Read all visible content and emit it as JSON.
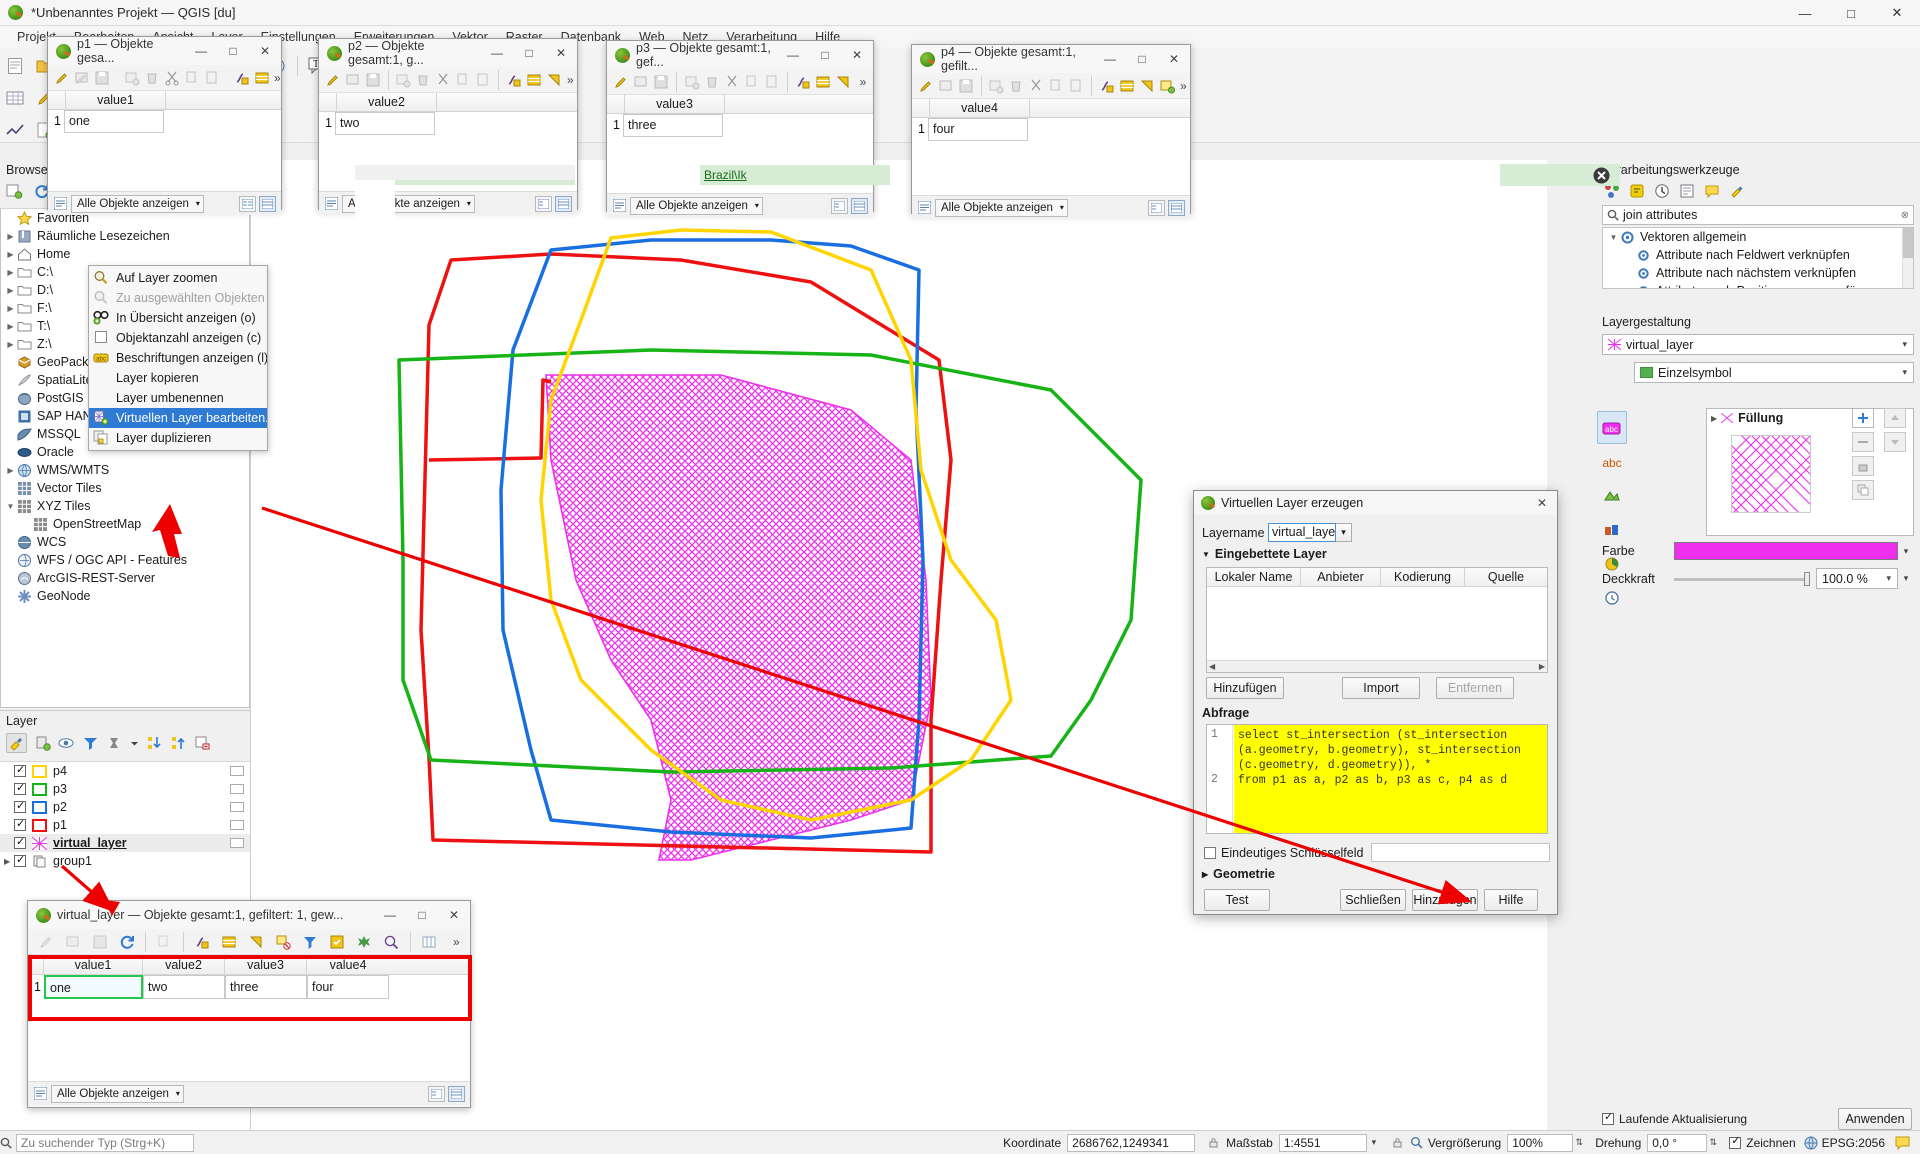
{
  "window": {
    "title": "*Unbenanntes Projekt — QGIS [du]",
    "minimize": "—",
    "maximize": "□",
    "close": "✕"
  },
  "menubar": [
    "Projekt",
    "Bearbeiten",
    "Ansicht",
    "Layer",
    "Einstellungen",
    "Erweiterungen",
    "Vektor",
    "Raster",
    "Datenbank",
    "Web",
    "Netz",
    "Verarbeitung",
    "Hilfe"
  ],
  "browser": {
    "title": "Browser",
    "items": [
      {
        "label": "Favoriten",
        "icon": "star-icon",
        "arrow": false,
        "indent": 0
      },
      {
        "label": "Räumliche Lesezeichen",
        "icon": "bookmark-icon",
        "arrow": true,
        "indent": 0
      },
      {
        "label": "Home",
        "icon": "home-icon",
        "arrow": true,
        "indent": 0
      },
      {
        "label": "C:\\",
        "icon": "folder-icon",
        "arrow": true,
        "indent": 0
      },
      {
        "label": "D:\\",
        "icon": "folder-icon",
        "arrow": true,
        "indent": 0
      },
      {
        "label": "F:\\",
        "icon": "folder-icon",
        "arrow": true,
        "indent": 0
      },
      {
        "label": "T:\\",
        "icon": "folder-icon",
        "arrow": true,
        "indent": 0
      },
      {
        "label": "Z:\\",
        "icon": "folder-icon",
        "arrow": true,
        "indent": 0
      },
      {
        "label": "GeoPackage",
        "icon": "geopackage-icon",
        "arrow": false,
        "indent": 0
      },
      {
        "label": "SpatiaLite",
        "icon": "spatialite-icon",
        "arrow": false,
        "indent": 0
      },
      {
        "label": "PostGIS",
        "icon": "postgis-icon",
        "arrow": false,
        "indent": 0
      },
      {
        "label": "SAP HANA",
        "icon": "saphana-icon",
        "arrow": false,
        "indent": 0
      },
      {
        "label": "MSSQL",
        "icon": "mssql-icon",
        "arrow": false,
        "indent": 0
      },
      {
        "label": "Oracle",
        "icon": "oracle-icon",
        "arrow": false,
        "indent": 0
      },
      {
        "label": "WMS/WMTS",
        "icon": "wms-icon",
        "arrow": true,
        "indent": 0
      },
      {
        "label": "Vector Tiles",
        "icon": "vectortiles-icon",
        "arrow": false,
        "indent": 0
      },
      {
        "label": "XYZ Tiles",
        "icon": "xyztiles-icon",
        "arrow": true,
        "expanded": true,
        "indent": 0
      },
      {
        "label": "OpenStreetMap",
        "icon": "xyztiles-icon",
        "arrow": false,
        "indent": 1
      },
      {
        "label": "WCS",
        "icon": "wcs-icon",
        "arrow": false,
        "indent": 0
      },
      {
        "label": "WFS / OGC API - Features",
        "icon": "wfs-icon",
        "arrow": false,
        "indent": 0
      },
      {
        "label": "ArcGIS-REST-Server",
        "icon": "arcgis-icon",
        "arrow": false,
        "indent": 0
      },
      {
        "label": "GeoNode",
        "icon": "geonode-icon",
        "arrow": false,
        "indent": 0
      }
    ]
  },
  "layers": {
    "title": "Layer",
    "items": [
      {
        "label": "p4",
        "color": "#ffd400",
        "checked": true,
        "type": "vector",
        "bold": false
      },
      {
        "label": "p3",
        "color": "#17b417",
        "checked": true,
        "type": "vector",
        "bold": false
      },
      {
        "label": "p2",
        "color": "#1a6fe0",
        "checked": true,
        "type": "vector",
        "bold": false
      },
      {
        "label": "p1",
        "color": "#ee1111",
        "checked": true,
        "type": "vector",
        "bold": false
      },
      {
        "label": "virtual_layer",
        "color": "#e040e0",
        "checked": true,
        "type": "virtual",
        "bold": true,
        "selected": true
      },
      {
        "label": "group1",
        "color": "",
        "checked": true,
        "type": "group",
        "bold": false,
        "arrow": true
      }
    ]
  },
  "context_menu": {
    "items": [
      {
        "label": "Auf Layer zoomen",
        "icon": "zoom-layer-icon",
        "state": "normal"
      },
      {
        "label": "Zu ausgewählten Objekten zoomen",
        "icon": "zoom-selection-icon",
        "state": "disabled"
      },
      {
        "label": "In Übersicht anzeigen (o)",
        "icon": "overview-icon",
        "state": "normal"
      },
      {
        "label": "Objektanzahl anzeigen (c)",
        "icon": "checkbox-icon",
        "state": "normal"
      },
      {
        "label": "Beschriftungen anzeigen (l)",
        "icon": "labels-icon",
        "state": "normal"
      },
      {
        "label": "Layer kopieren",
        "icon": "",
        "state": "normal"
      },
      {
        "label": "Layer umbenennen",
        "icon": "",
        "state": "normal"
      },
      {
        "label": "Virtuellen Layer bearbeiten...",
        "icon": "virtual-layer-icon",
        "state": "highlighted"
      },
      {
        "label": "Layer duplizieren",
        "icon": "duplicate-icon",
        "state": "normal"
      }
    ]
  },
  "attribute_windows": [
    {
      "id": "p1",
      "title": "p1 — Objekte gesa...",
      "column": "value1",
      "row_number": "1",
      "value": "one",
      "status_label": "Alle Objekte anzeigen"
    },
    {
      "id": "p2",
      "title": "p2 — Objekte gesamt:1, g...",
      "column": "value2",
      "row_number": "1",
      "value": "two",
      "status_label": "Alle Objekte anzeigen"
    },
    {
      "id": "p3",
      "title": "p3 — Objekte gesamt:1, gef...",
      "column": "value3",
      "row_number": "1",
      "value": "three",
      "status_label": "Alle Objekte anzeigen"
    },
    {
      "id": "p4",
      "title": "p4 — Objekte gesamt:1, gefilt...",
      "column": "value4",
      "row_number": "1",
      "value": "four",
      "status_label": "Alle Objekte anzeigen"
    }
  ],
  "virtual_table": {
    "title": "virtual_layer — Objekte gesamt:1, gefiltert: 1, gew...",
    "columns": [
      "value1",
      "value2",
      "value3",
      "value4"
    ],
    "row_number": "1",
    "row": [
      "one",
      "two",
      "three",
      "four"
    ],
    "status_label": "Alle Objekte anzeigen"
  },
  "processing": {
    "title": "Verarbeitungswerkzeuge",
    "search_value": "join attributes",
    "tree": [
      {
        "label": "Vektoren allgemein",
        "icon": "folder-gear-icon",
        "indent": 0,
        "arrow": true
      },
      {
        "label": "Attribute nach Feldwert verknüpfen",
        "icon": "gear-icon",
        "indent": 1
      },
      {
        "label": "Attribute nach nächstem verknüpfen",
        "icon": "gear-icon",
        "indent": 1
      },
      {
        "label": "Attribute nach Position zusammenfügen",
        "icon": "gear-icon",
        "indent": 1
      }
    ]
  },
  "styling": {
    "title": "Layergestaltung",
    "layer_value": "virtual_layer",
    "renderer_value": "Einzelsymbol",
    "tree_root": "Füllung",
    "color_label": "Farbe",
    "color_value": "#ee30ee",
    "opacity_label": "Deckkraft",
    "opacity_value": "100.0 %",
    "sidetabs": [
      "symbology-icon",
      "labels-icon",
      "masks-icon",
      "3dview-icon",
      "diagrams-icon",
      "history-icon"
    ]
  },
  "virtual_dialog": {
    "title": "Virtuellen Layer erzeugen",
    "layername_label": "Layername",
    "layername_value": "virtual_layer",
    "embedded_group": "Eingebettete Layer",
    "table_headers": [
      "Lokaler Name",
      "Anbieter",
      "Kodierung",
      "Quelle"
    ],
    "buttons_row": [
      "Hinzufügen",
      "Import",
      "Entfernen"
    ],
    "query_label": "Abfrage",
    "query_lines": [
      {
        "no": "1",
        "text": "select st_intersection (st_intersection (a.geometry, b.geometry), st_intersection (c.geometry, d.geometry)), *"
      },
      {
        "no": "2",
        "text": "from p1 as a, p2 as b, p3 as c, p4 as d"
      }
    ],
    "unique_key_label": "Eindeutiges Schlüsselfeld",
    "geometry_group": "Geometrie",
    "footer_buttons": [
      "Test",
      "Schließen",
      "Hinzufügen",
      "Hilfe"
    ],
    "close_icon": "✕"
  },
  "statusbar": {
    "search_placeholder": "Zu suchender Typ (Strg+K)",
    "coordinate_label": "Koordinate",
    "coordinate_value": "2686762,1249341",
    "scale_label": "Maßstab",
    "scale_value": "1:4551",
    "magnifier_label": "Vergrößerung",
    "magnifier_value": "100%",
    "rotation_label": "Drehung",
    "rotation_value": "0,0 °",
    "render_label": "Zeichnen",
    "crs_label": "EPSG:2056",
    "extra_label": "Laufende Aktualisierung",
    "extra2_label": "Anwenden"
  }
}
